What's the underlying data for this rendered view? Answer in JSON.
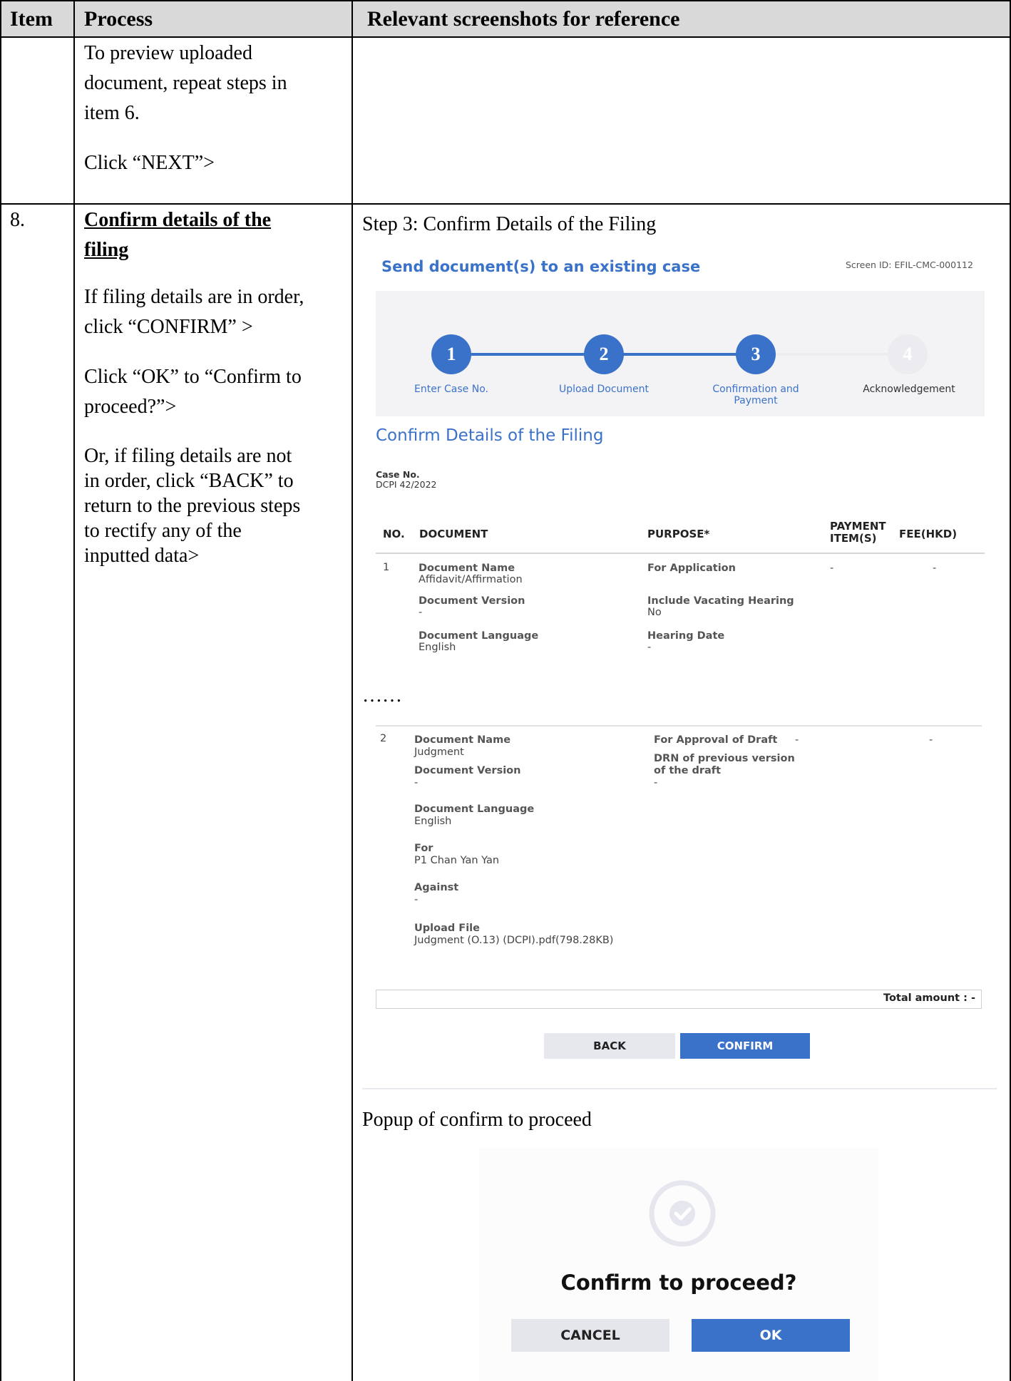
{
  "table": {
    "headers": {
      "item": "Item",
      "process": "Process",
      "screens": "Relevant screenshots for reference"
    },
    "row1": {
      "lines": [
        "To preview uploaded",
        "document, repeat steps in",
        "item 6."
      ],
      "next": "Click “NEXT”>"
    },
    "row2": {
      "item": "8.",
      "title_l1": "Confirm details of the",
      "title_l2": "filing",
      "p1_l1": "If filing details are in order,",
      "p1_l2": "click “CONFIRM” >",
      "p2_l1": "Click “OK” to “Confirm to",
      "p2_l2": "proceed?”>",
      "p3": [
        "Or, if filing details are not",
        "in order, click “BACK” to",
        "return to the previous steps",
        "to rectify any of the",
        "inputted data>"
      ]
    }
  },
  "screens": {
    "step3_caption": "Step 3: Confirm Details of the Filing",
    "popup_caption": "Popup of confirm to proceed",
    "ellipsis": "……"
  },
  "app": {
    "title": "Send document(s) to an existing case",
    "screen_id": "Screen ID: EFIL-CMC-000112",
    "steps": [
      {
        "num": "1",
        "label": "Enter Case No."
      },
      {
        "num": "2",
        "label": "Upload Document"
      },
      {
        "num": "3",
        "label": "Confirmation and Payment"
      },
      {
        "num": "4",
        "label": "Acknowledgement"
      }
    ],
    "section_title": "Confirm Details of the Filing",
    "case_label": "Case No.",
    "case_value": "DCPI 42/2022",
    "columns": {
      "no": "NO.",
      "document": "DOCUMENT",
      "purpose": "PURPOSE*",
      "payment": "PAYMENT ITEM(S)",
      "fee": "FEE(HKD)"
    },
    "row1": {
      "no": "1",
      "doc_name_label": "Document Name",
      "doc_name": "Affidavit/Affirmation",
      "doc_version_label": "Document Version",
      "doc_version": "-",
      "doc_language_label": "Document Language",
      "doc_language": "English",
      "purpose": "For Application",
      "vacating_label": "Include Vacating Hearing",
      "vacating": "No",
      "hearing_label": "Hearing Date",
      "hearing": "-",
      "payment": "-",
      "fee": "-"
    },
    "row2": {
      "no": "2",
      "doc_name_label": "Document Name",
      "doc_name": "Judgment",
      "doc_version_label": "Document Version",
      "doc_version": "-",
      "doc_language_label": "Document Language",
      "doc_language": "English",
      "for_label": "For",
      "for_value": "P1 Chan Yan Yan",
      "against_label": "Against",
      "against": "-",
      "upload_label": "Upload File",
      "upload": "Judgment (O.13) (DCPI).pdf(798.28KB)",
      "purpose": "For Approval of Draft",
      "drn_label": "DRN of previous version of the draft",
      "drn": "-",
      "payment": "-",
      "fee": "-"
    },
    "total": "Total amount : -",
    "back": "BACK",
    "confirm": "CONFIRM"
  },
  "popup": {
    "title": "Confirm to proceed?",
    "cancel": "CANCEL",
    "ok": "OK"
  },
  "colors": {
    "accent": "#3b72c9",
    "header_bg": "#d9d9d9",
    "stepper_bg": "#f3f3f5"
  }
}
